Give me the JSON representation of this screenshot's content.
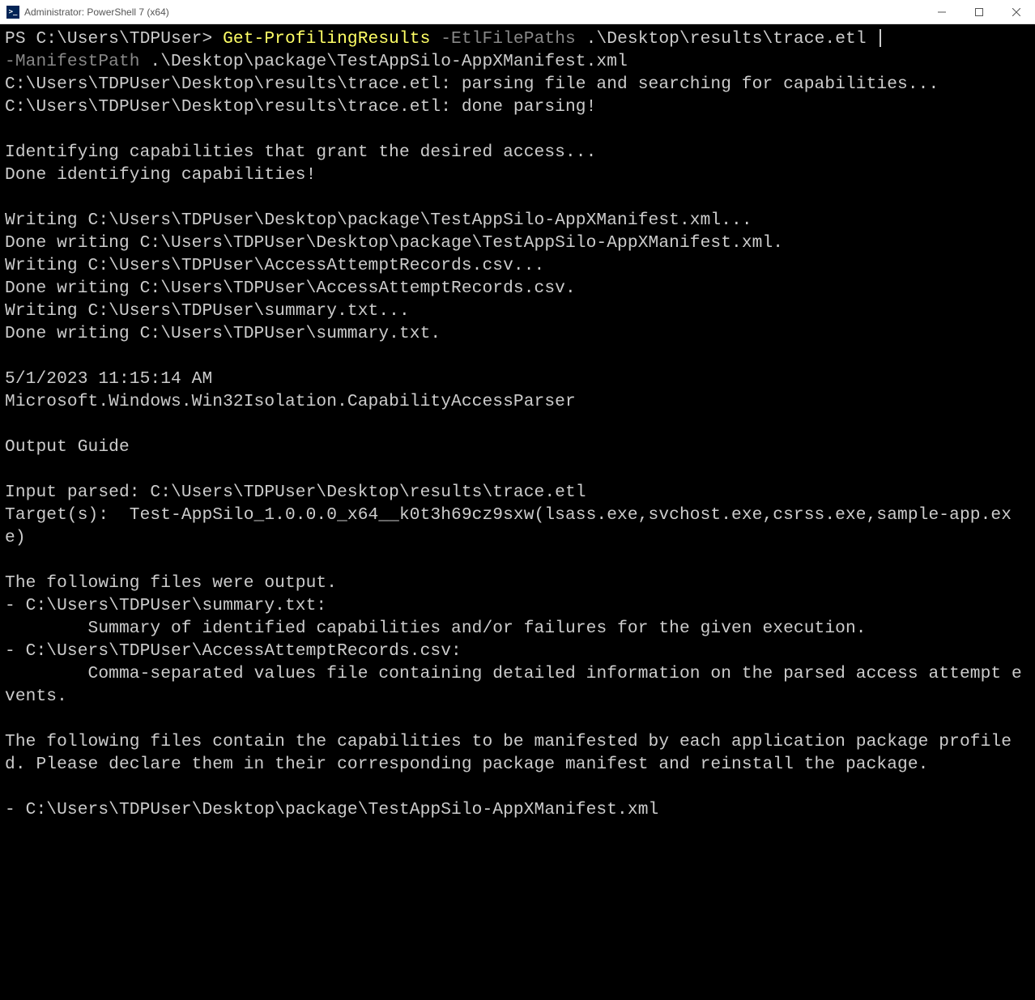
{
  "titlebar": {
    "icon_label": ">_",
    "title": "Administrator: PowerShell 7 (x64)"
  },
  "command": {
    "prompt": "PS C:\\Users\\TDPUser> ",
    "cmdlet": "Get-ProfilingResults",
    "space1": " ",
    "param1": "-EtlFilePaths",
    "arg1": " .\\Desktop\\results\\trace.etl ",
    "param2": "-ManifestPath",
    "arg2": " .\\Desktop\\package\\TestAppSilo-AppXManifest.xml"
  },
  "output": "C:\\Users\\TDPUser\\Desktop\\results\\trace.etl: parsing file and searching for capabilities...\nC:\\Users\\TDPUser\\Desktop\\results\\trace.etl: done parsing!\n\nIdentifying capabilities that grant the desired access...\nDone identifying capabilities!\n\nWriting C:\\Users\\TDPUser\\Desktop\\package\\TestAppSilo-AppXManifest.xml...\nDone writing C:\\Users\\TDPUser\\Desktop\\package\\TestAppSilo-AppXManifest.xml.\nWriting C:\\Users\\TDPUser\\AccessAttemptRecords.csv...\nDone writing C:\\Users\\TDPUser\\AccessAttemptRecords.csv.\nWriting C:\\Users\\TDPUser\\summary.txt...\nDone writing C:\\Users\\TDPUser\\summary.txt.\n\n5/1/2023 11:15:14 AM\nMicrosoft.Windows.Win32Isolation.CapabilityAccessParser\n\nOutput Guide\n\nInput parsed: C:\\Users\\TDPUser\\Desktop\\results\\trace.etl\nTarget(s):  Test-AppSilo_1.0.0.0_x64__k0t3h69cz9sxw(lsass.exe,svchost.exe,csrss.exe,sample-app.exe)\n\nThe following files were output.\n- C:\\Users\\TDPUser\\summary.txt:\n        Summary of identified capabilities and/or failures for the given execution.\n- C:\\Users\\TDPUser\\AccessAttemptRecords.csv:\n        Comma-separated values file containing detailed information on the parsed access attempt events.\n\nThe following files contain the capabilities to be manifested by each application package profiled. Please declare them in their corresponding package manifest and reinstall the package.\n\n- C:\\Users\\TDPUser\\Desktop\\package\\TestAppSilo-AppXManifest.xml"
}
